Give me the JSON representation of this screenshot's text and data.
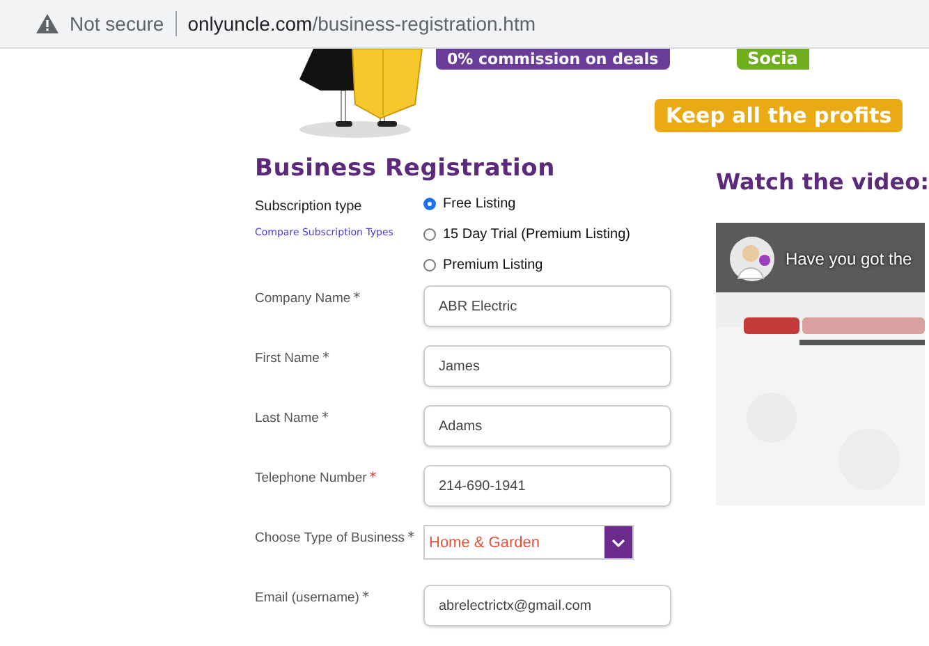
{
  "browser": {
    "security": "Not secure",
    "url_domain": "onlyuncle.com",
    "url_path": "/business-registration.htm"
  },
  "banners": [
    {
      "text": "0% commission on deals",
      "kind": "purple"
    },
    {
      "text": "Socia",
      "kind": "green"
    },
    {
      "text": "Keep all the profits",
      "kind": "gold"
    }
  ],
  "form": {
    "title": "Business Registration",
    "subscription_label": "Subscription type",
    "compare_link": "Compare Subscription Types",
    "options": [
      {
        "label": "Free Listing",
        "selected": true
      },
      {
        "label": "15 Day Trial (Premium Listing)",
        "selected": false
      },
      {
        "label": "Premium Listing",
        "selected": false
      }
    ],
    "fields": [
      {
        "label": "Company Name",
        "required": "*",
        "value": "ABR Electric",
        "kind": "text",
        "required_red": false
      },
      {
        "label": "First Name",
        "required": "*",
        "value": "James",
        "kind": "text",
        "required_red": false
      },
      {
        "label": "Last Name",
        "required": "*",
        "value": "Adams",
        "kind": "text",
        "required_red": false
      },
      {
        "label": "Telephone Number",
        "required": "*",
        "value": "214-690-1941",
        "kind": "text",
        "required_red": true
      },
      {
        "label": "Choose Type of Business",
        "required": "*",
        "value": "Home & Garden",
        "kind": "select",
        "required_red": false
      },
      {
        "label": "Email (username)",
        "required": "*",
        "value": "abrelectrictx@gmail.com",
        "kind": "text",
        "required_red": false
      }
    ]
  },
  "video": {
    "heading": "Watch the video:",
    "title": "Have you got the"
  }
}
